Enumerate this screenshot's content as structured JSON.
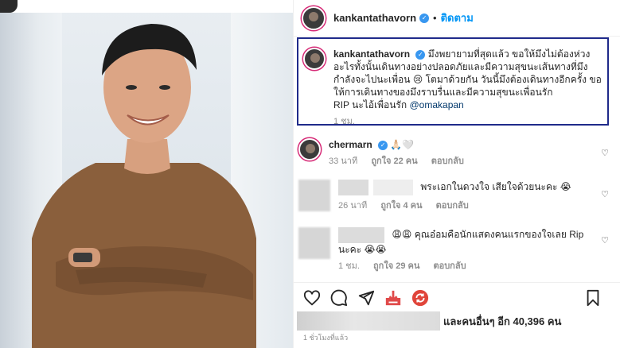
{
  "post": {
    "username": "kankantathavorn",
    "follow_label": "ติดตาม",
    "separator": "•"
  },
  "caption": {
    "username": "kankantathavorn",
    "text": "มึงพยายามที่สุดแล้ว ขอให้มึงไม่ต้องห่วงอะไรทั้งนั้นเดินทางอย่างปลอดภัยและมีความสุขนะเส้นทางที่มึงกำลังจะไปนะเพื่อน 😢 โตมาด้วยกัน วันนี้มึงต้องเดินทางอีกครั้ง ขอให้การเดินทางของมึงราบรื่นและมีความสุขนะเพื่อนรัก",
    "rip_line": "RIP นะไอ้เพื่อนรัก",
    "mention": "@omakapan",
    "time": "1 ชม."
  },
  "comments": [
    {
      "username": "chermarn",
      "text": "🙏🏻🤍",
      "time": "33 นาที",
      "likes": "ถูกใจ 22 คน",
      "reply": "ตอบกลับ"
    },
    {
      "username": "",
      "text": "พระเอกในดวงใจ เสียใจด้วยนะคะ 😭",
      "time": "26 นาที",
      "likes": "ถูกใจ 4 คน",
      "reply": "ตอบกลับ"
    },
    {
      "username": "",
      "text": "😩😩 คุณอ๋อมคือนักแสดงคนแรกของใจเลย Rip นะคะ 😭😭",
      "time": "1 ชม.",
      "likes": "ถูกใจ 29 คน",
      "reply": "ตอบกลับ"
    }
  ],
  "likes": {
    "text": "และคนอื่นๆ อีก 40,396 คน"
  },
  "posted_ago": "1 ชั่วโมงที่แล้ว",
  "icons": [
    "heart-icon",
    "comment-icon",
    "share-icon",
    "download-icon",
    "repost-icon",
    "bookmark-icon"
  ],
  "colors": {
    "follow": "#0095f6",
    "highlight_border": "#1f2a8a",
    "verified": "#3897f0"
  }
}
